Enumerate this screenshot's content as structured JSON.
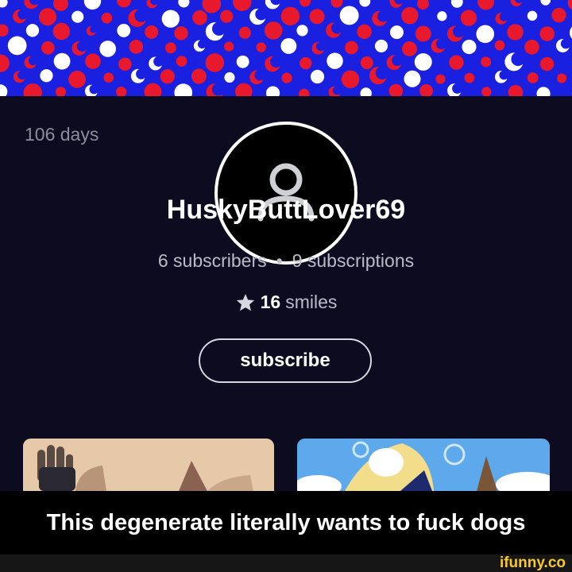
{
  "profile": {
    "days": "106 days",
    "username": "HuskyButtLover69",
    "subscribers": "6 subscribers",
    "separator": "•",
    "subscriptions": "9 subscriptions",
    "smiles_count": "16",
    "smiles_label": "smiles",
    "subscribe_label": "subscribe"
  },
  "icons": {
    "avatar": "user-icon",
    "smiles": "star-icon"
  },
  "caption": "This degenerate literally wants to fuck dogs",
  "watermark": "ifunny.co",
  "colors": {
    "background": "#0d0b20",
    "banner_blue": "#1a20e0",
    "banner_red": "#e8192c",
    "caption_bg": "#000000",
    "watermark": "#f7c92c"
  }
}
